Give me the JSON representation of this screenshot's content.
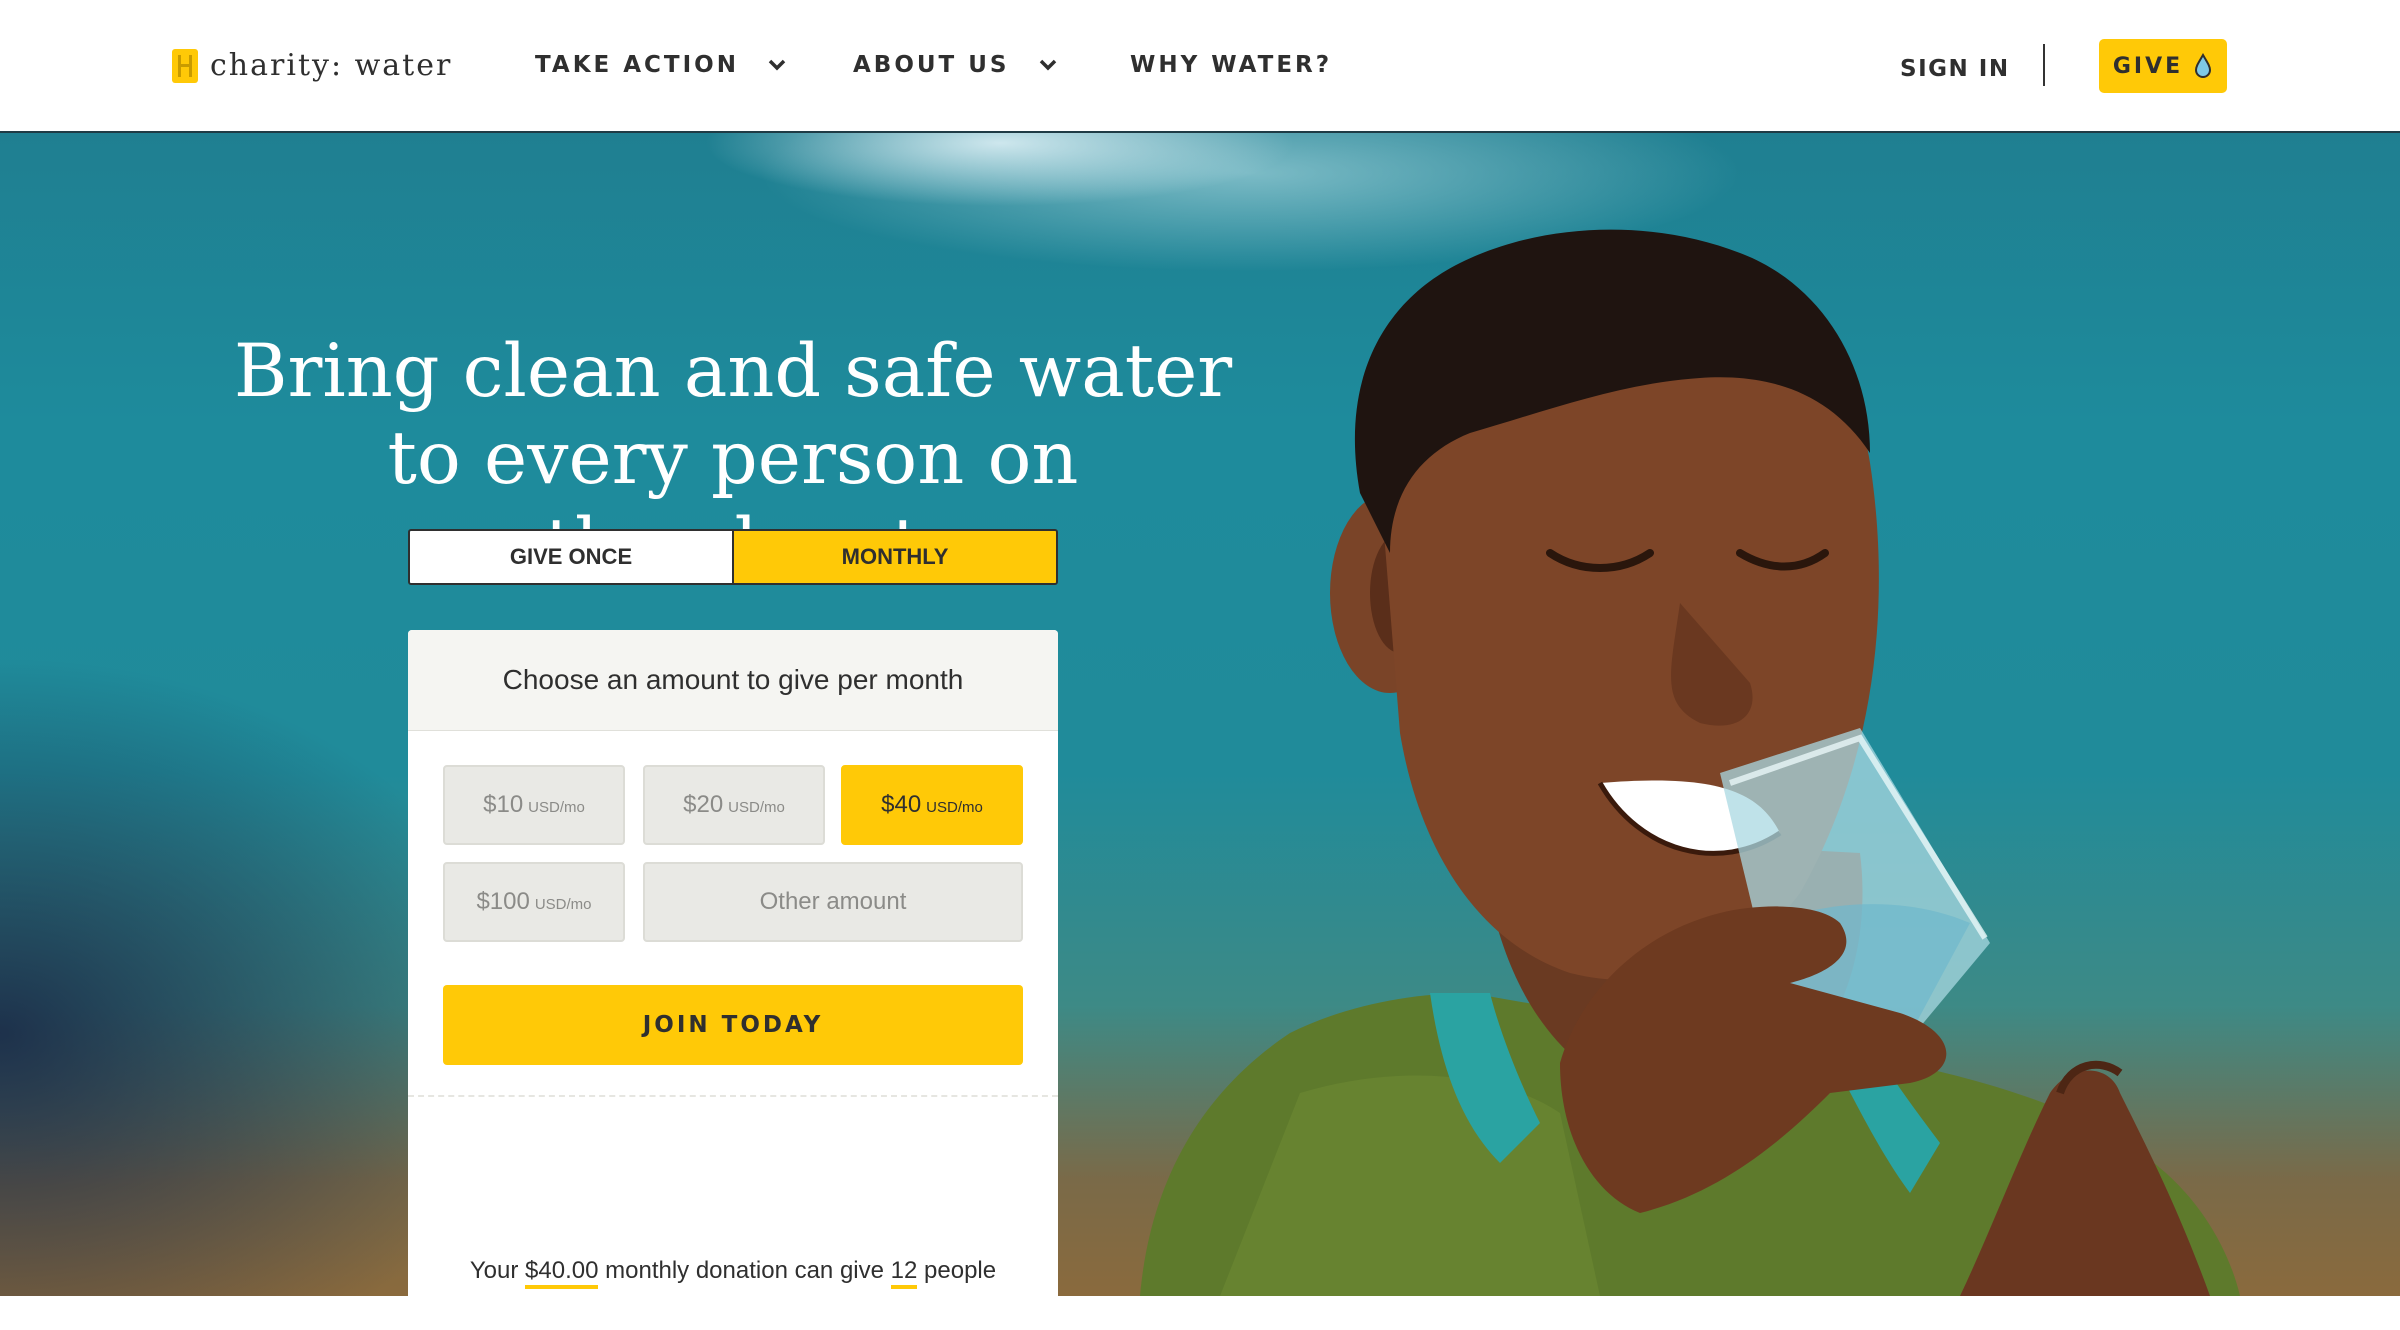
{
  "header": {
    "logo_text": "charity: water",
    "nav": [
      {
        "label": "TAKE ACTION",
        "has_dropdown": true
      },
      {
        "label": "ABOUT US",
        "has_dropdown": true
      },
      {
        "label": "WHY WATER?",
        "has_dropdown": false
      }
    ],
    "sign_in": "SIGN IN",
    "give": "GIVE"
  },
  "hero": {
    "headline": [
      "Bring clean and safe water",
      "to every person on",
      "the planet"
    ],
    "toggle": {
      "once": "GIVE ONCE",
      "monthly": "MONTHLY",
      "selected": "monthly"
    },
    "card": {
      "title": "Choose an amount to give per month",
      "amounts": [
        {
          "value": "$10",
          "unit": "USD/mo",
          "selected": false
        },
        {
          "value": "$20",
          "unit": "USD/mo",
          "selected": false
        },
        {
          "value": "$40",
          "unit": "USD/mo",
          "selected": true
        },
        {
          "value": "$100",
          "unit": "USD/mo",
          "selected": false
        }
      ],
      "other_amount": "Other amount",
      "join": "JOIN TODAY",
      "impact": {
        "prefix": "Your",
        "amount": "$40.00",
        "middle": "monthly donation can give",
        "people": "12",
        "suffix": "people"
      }
    }
  },
  "colors": {
    "accent": "#ffc907",
    "text": "#2f2f2f",
    "hero_sky": "#1e8b9c"
  },
  "icons": [
    "jerrycan-logo-icon",
    "chevron-down-icon",
    "water-drop-icon"
  ]
}
